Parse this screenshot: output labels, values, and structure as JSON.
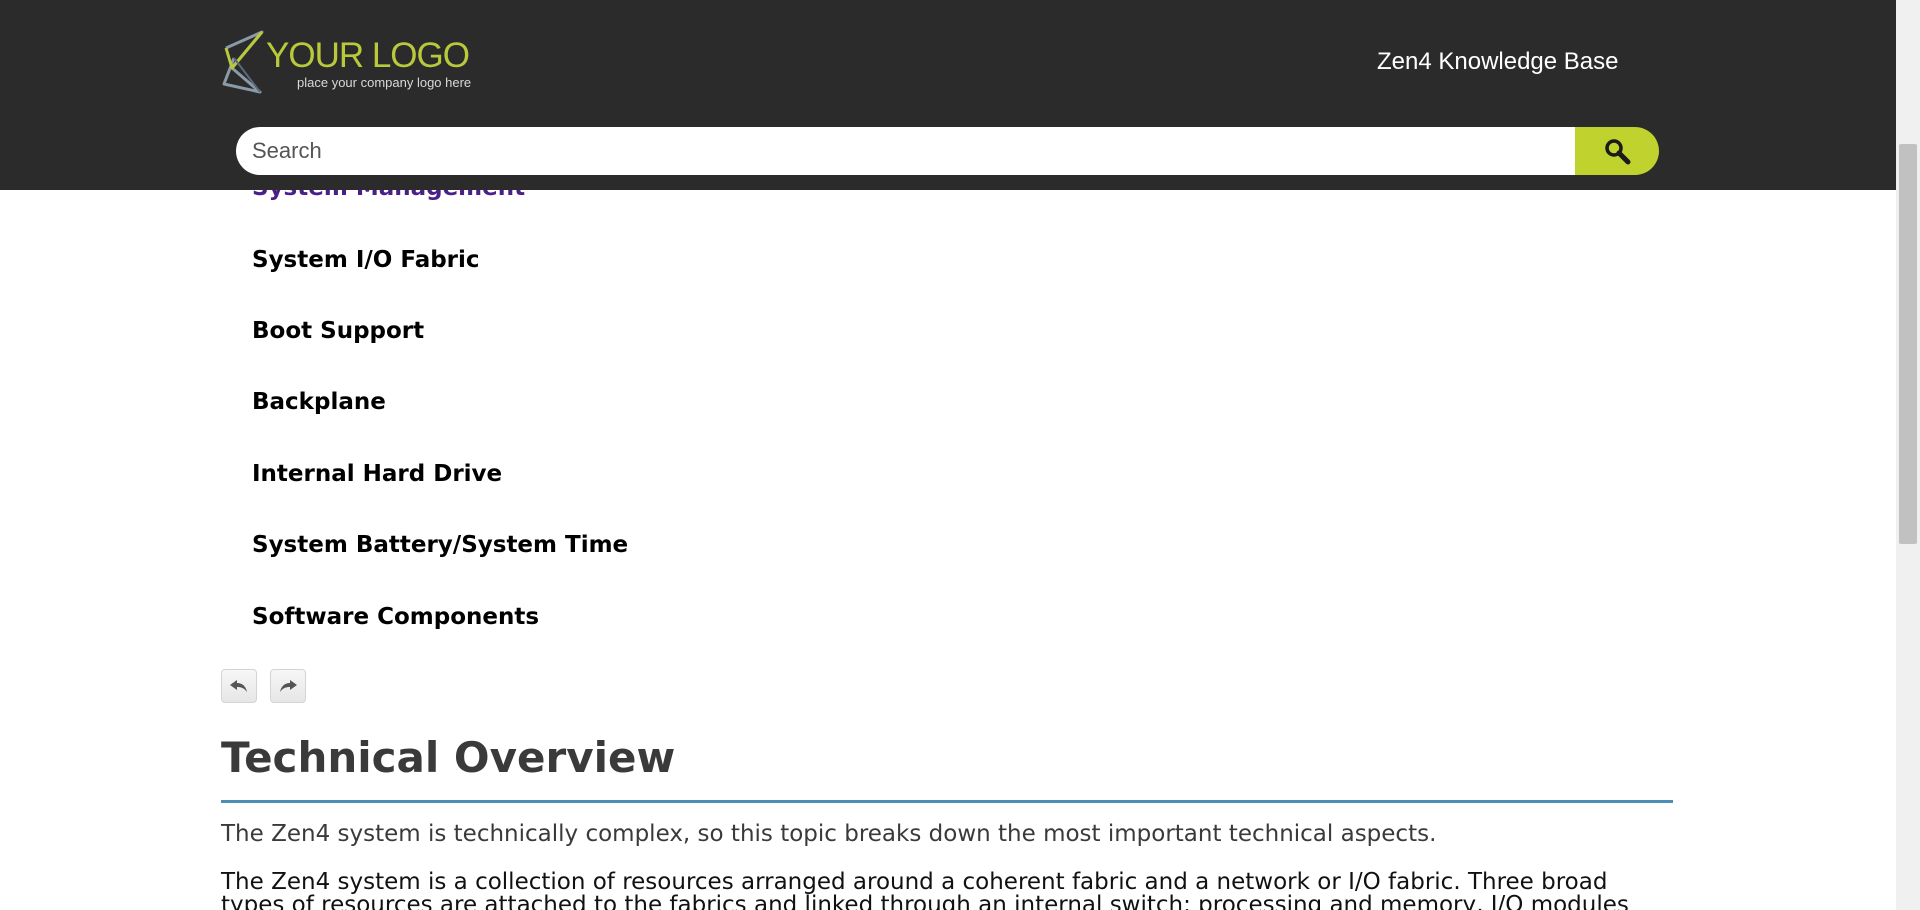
{
  "header": {
    "logo_title": "YOUR LOGO",
    "logo_subtitle": "place your company logo here",
    "kb_title": "Zen4 Knowledge Base"
  },
  "search": {
    "placeholder": "Search",
    "button_icon": "magnifier-icon"
  },
  "nav": {
    "items": [
      {
        "label": "System Management"
      },
      {
        "label": "System I/O Fabric"
      },
      {
        "label": "Boot Support"
      },
      {
        "label": "Backplane"
      },
      {
        "label": "Internal Hard Drive"
      },
      {
        "label": "System Battery/System Time"
      },
      {
        "label": "Software Components"
      }
    ]
  },
  "arrows": {
    "back_icon": "back-arrow-icon",
    "forward_icon": "forward-arrow-icon"
  },
  "content": {
    "heading": "Technical Overview",
    "intro": "The Zen4 system is technically complex, so this topic breaks down the most important technical aspects.",
    "body": "The Zen4 system is a collection of resources arranged around a coherent fabric and a network or I/O fabric. Three broad types of resources are attached to the fabrics and linked through an internal switch: processing and memory, I/O modules (Ethernet"
  },
  "colors": {
    "header_bg": "#2b2b2b",
    "accent": "#bfd22e",
    "visited_link": "#4b1f8a",
    "heading_rule": "#4a8fb3"
  }
}
